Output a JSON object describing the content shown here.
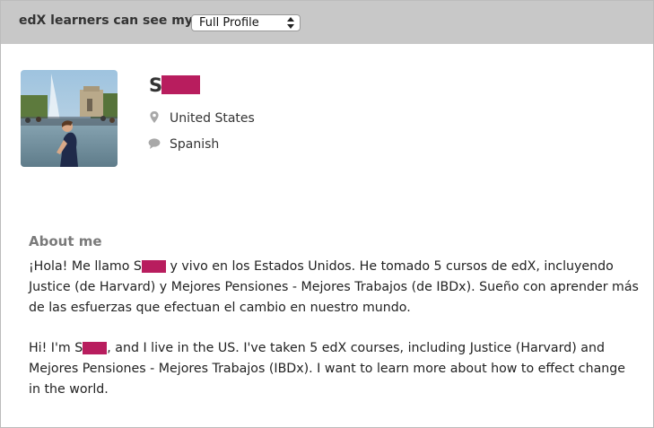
{
  "visibility": {
    "label": "edX learners can see my:",
    "selected_option": "Full Profile"
  },
  "profile": {
    "name_initial": "S",
    "location": "United States",
    "language": "Spanish"
  },
  "about": {
    "heading": "About me",
    "bio_es_part1": "¡Hola! Me llamo S",
    "bio_es_part2": " y vivo en los Estados Unidos. He tomado 5 cursos de edX, incluyendo Justice (de Harvard) y Mejores Pensiones - Mejores Trabajos (de IBDx). Sueño con aprender más de las esfuerzas que efectuan el cambio en nuestro mundo.",
    "bio_en_part1": "Hi! I'm S",
    "bio_en_part2": ", and I live in the US. I've taken 5 edX courses, including Justice (Harvard) and Mejores Pensiones - Mejores Trabajos (IBDx). I want to learn more about how to effect change in the world."
  },
  "colors": {
    "header_bar": "#c8c8c8",
    "redaction": "#b81d5e",
    "heading_gray": "#7a7a7a",
    "icon_gray": "#a8a8a8"
  },
  "icons": {
    "location": "map-pin-icon",
    "language": "speech-bubble-icon",
    "select": "up-down-arrows-icon"
  }
}
